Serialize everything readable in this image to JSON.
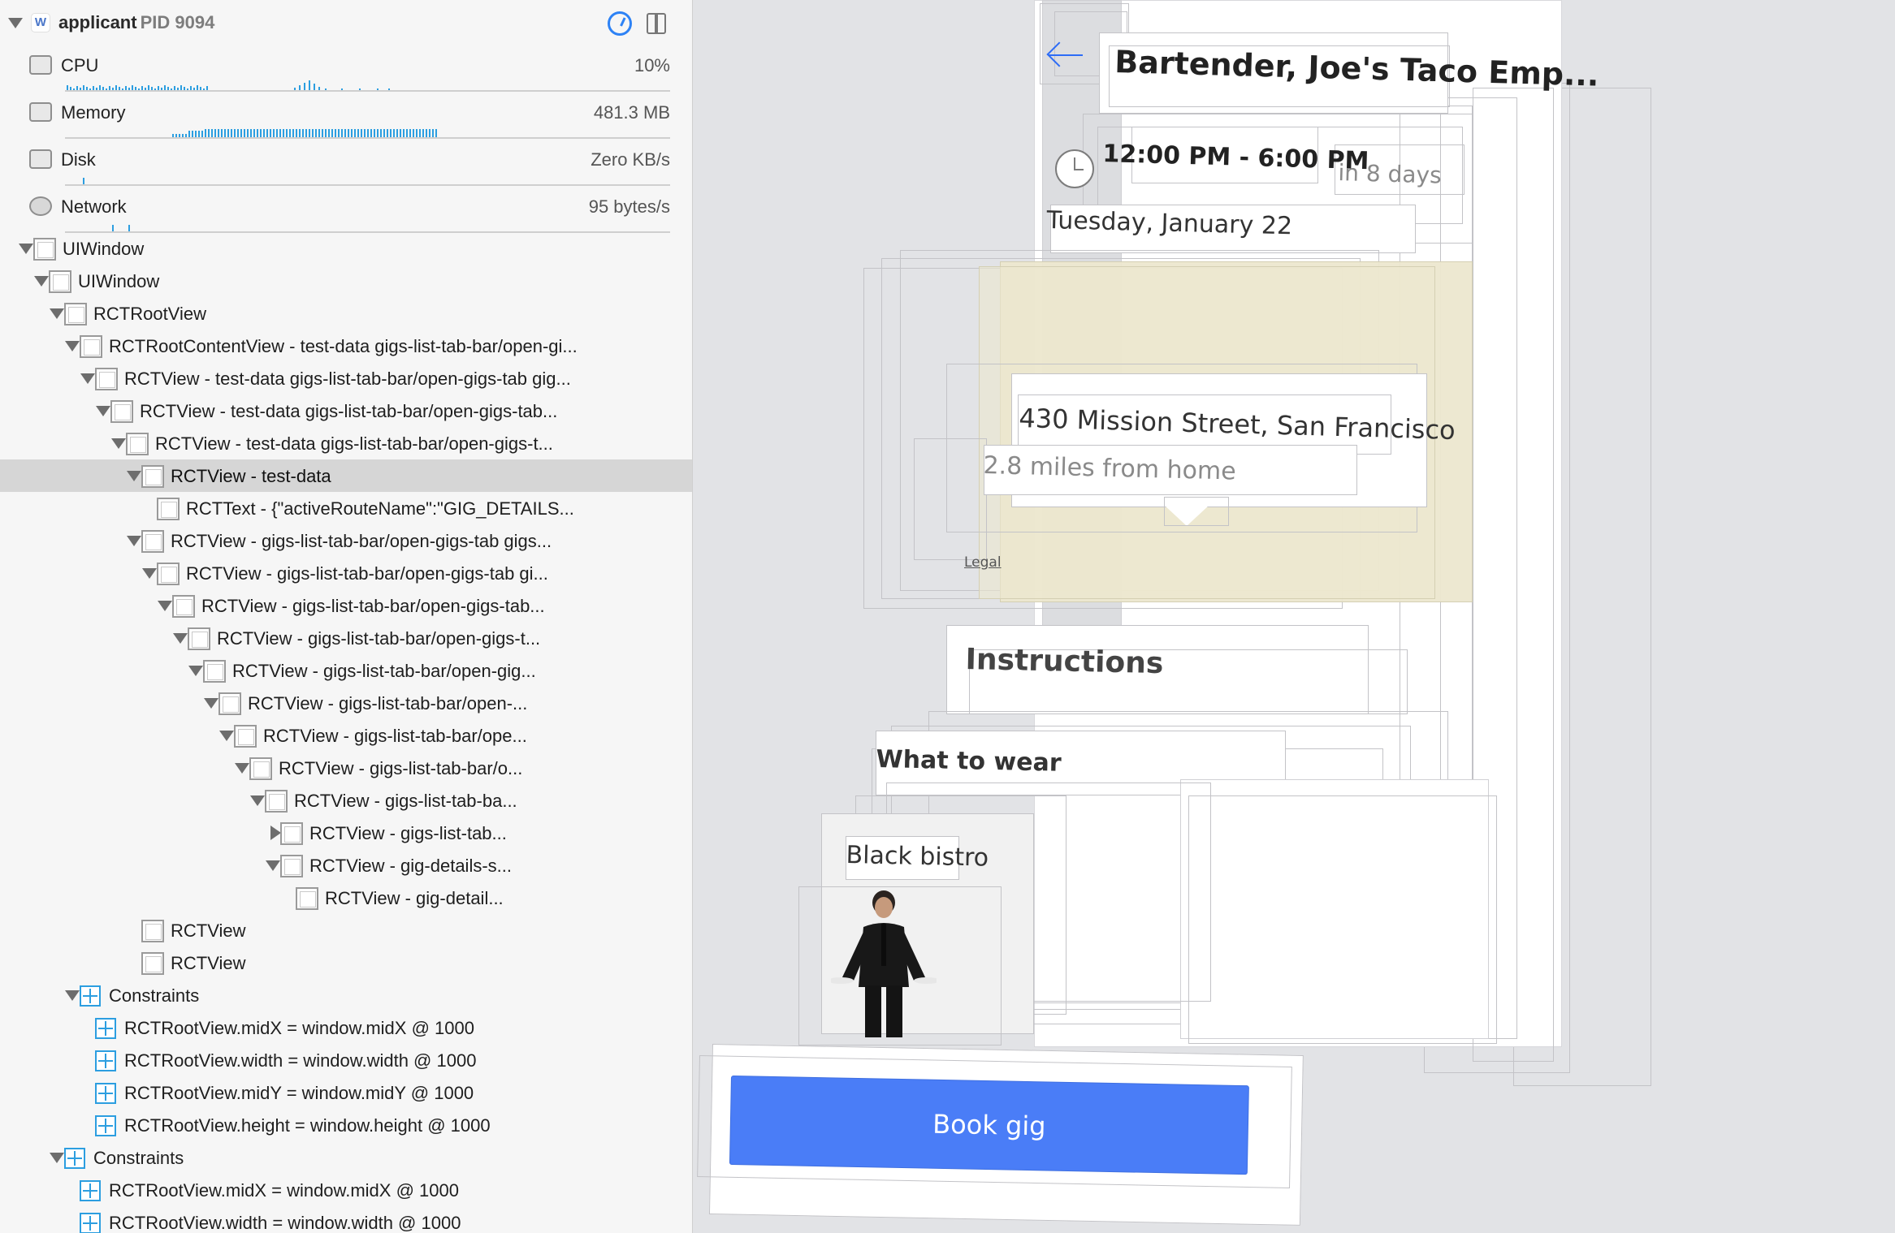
{
  "process": {
    "name": "applicant",
    "pid_label": "PID 9094"
  },
  "gauges": [
    {
      "label": "CPU",
      "value": "10%"
    },
    {
      "label": "Memory",
      "value": "481.3 MB"
    },
    {
      "label": "Disk",
      "value": "Zero KB/s"
    },
    {
      "label": "Network",
      "value": "95 bytes/s"
    }
  ],
  "tree": [
    {
      "label": "UIWindow"
    },
    {
      "label": "UIWindow"
    },
    {
      "label": "RCTRootView"
    },
    {
      "label": "RCTRootContentView - test-data gigs-list-tab-bar/open-gi..."
    },
    {
      "label": "RCTView - test-data gigs-list-tab-bar/open-gigs-tab gig..."
    },
    {
      "label": "RCTView - test-data gigs-list-tab-bar/open-gigs-tab..."
    },
    {
      "label": "RCTView - test-data gigs-list-tab-bar/open-gigs-t..."
    },
    {
      "label": "RCTView - test-data"
    },
    {
      "label": "RCTText - {\"activeRouteName\":\"GIG_DETAILS..."
    },
    {
      "label": "RCTView - gigs-list-tab-bar/open-gigs-tab gigs..."
    },
    {
      "label": "RCTView - gigs-list-tab-bar/open-gigs-tab gi..."
    },
    {
      "label": "RCTView - gigs-list-tab-bar/open-gigs-tab..."
    },
    {
      "label": "RCTView - gigs-list-tab-bar/open-gigs-t..."
    },
    {
      "label": "RCTView - gigs-list-tab-bar/open-gig..."
    },
    {
      "label": "RCTView - gigs-list-tab-bar/open-..."
    },
    {
      "label": "RCTView - gigs-list-tab-bar/ope..."
    },
    {
      "label": "RCTView - gigs-list-tab-bar/o..."
    },
    {
      "label": "RCTView - gigs-list-tab-ba..."
    },
    {
      "label": "RCTView - gigs-list-tab..."
    },
    {
      "label": "RCTView - gig-details-s..."
    },
    {
      "label": "RCTView - gig-detail..."
    },
    {
      "label": "RCTView"
    },
    {
      "label": "RCTView"
    },
    {
      "label": "Constraints"
    },
    {
      "label": "RCTRootView.midX = window.midX @ 1000"
    },
    {
      "label": "RCTRootView.width = window.width @ 1000"
    },
    {
      "label": "RCTRootView.midY = window.midY @ 1000"
    },
    {
      "label": "RCTRootView.height = window.height @ 1000"
    },
    {
      "label": "Constraints"
    },
    {
      "label": "RCTRootView.midX = window.midX @ 1000"
    },
    {
      "label": "RCTRootView.width = window.width @ 1000"
    }
  ],
  "gig": {
    "title": "Bartender, Joe's Taco Emp...",
    "time": "12:00 PM - 6:00 PM",
    "relative": "in 8 days",
    "date": "Tuesday, January 22",
    "address": "430 Mission Street, San Francisco",
    "distance": "2.8 miles from home",
    "legal": "Legal",
    "instructions": "Instructions",
    "wear_heading": "What to wear",
    "wear_item": "Black bistro",
    "book_label": "Book gig"
  },
  "colors": {
    "accent": "#2d82f5",
    "book_button": "#4a7df7",
    "map_tint": "#ece7cf",
    "selection": "#d6d6d6"
  }
}
